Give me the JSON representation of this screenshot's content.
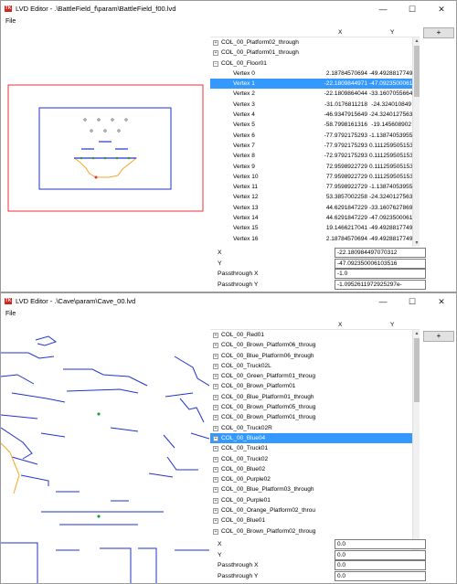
{
  "window1": {
    "title": "LVD Editor - .\\BattleField_f\\param\\BattleField_f00.lvd",
    "menu_file": "File",
    "col_x": "X",
    "col_y": "Y",
    "add_button": "+",
    "tree": [
      {
        "type": "group",
        "toggle": "+",
        "label": "COL_00_Platform02_through"
      },
      {
        "type": "group",
        "toggle": "+",
        "label": "COL_00_Platform01_through"
      },
      {
        "type": "group",
        "toggle": "−",
        "label": "COL_00_Floor01"
      },
      {
        "type": "vertex",
        "label": "Vertex 0",
        "x": "2.18784570694",
        "y": "-49.4928817749"
      },
      {
        "type": "vertex",
        "label": "Vertex 1",
        "x": "-22.1809844971",
        "y": "-47.0923500061",
        "selected": true
      },
      {
        "type": "vertex",
        "label": "Vertex 2",
        "x": "-22.1809864044",
        "y": "-33.1607055664"
      },
      {
        "type": "vertex",
        "label": "Vertex 3",
        "x": "-31.0176811218",
        "y": "-24.324010849"
      },
      {
        "type": "vertex",
        "label": "Vertex 4",
        "x": "-46.9347915649",
        "y": "-24.3240127563"
      },
      {
        "type": "vertex",
        "label": "Vertex 5",
        "x": "-58.7998161316",
        "y": "-19.145608902"
      },
      {
        "type": "vertex",
        "label": "Vertex 6",
        "x": "-77.9792175293",
        "y": "-1.13874053955"
      },
      {
        "type": "vertex",
        "label": "Vertex 7",
        "x": "-77.9792175293",
        "y": "0.111259505153"
      },
      {
        "type": "vertex",
        "label": "Vertex 8",
        "x": "-72.9792175293",
        "y": "0.111259505153"
      },
      {
        "type": "vertex",
        "label": "Vertex 9",
        "x": "72.9598922729",
        "y": "0.111259505153"
      },
      {
        "type": "vertex",
        "label": "Vertex 10",
        "x": "77.9598922729",
        "y": "0.111259505153"
      },
      {
        "type": "vertex",
        "label": "Vertex 11",
        "x": "77.9598922729",
        "y": "-1.13874053955"
      },
      {
        "type": "vertex",
        "label": "Vertex 12",
        "x": "53.3857002258",
        "y": "-24.3240127563"
      },
      {
        "type": "vertex",
        "label": "Vertex 13",
        "x": "44.6291847229",
        "y": "-33.1607627869"
      },
      {
        "type": "vertex",
        "label": "Vertex 14",
        "x": "44.6291847229",
        "y": "-47.0923500061"
      },
      {
        "type": "vertex",
        "label": "Vertex 15",
        "x": "19.1466217041",
        "y": "-49.4928817749"
      },
      {
        "type": "vertex",
        "label": "Vertex 16",
        "x": "2.18784570694",
        "y": "-49.4928817749"
      }
    ],
    "props": [
      {
        "label": "X",
        "value": "-22.180984497070312"
      },
      {
        "label": "Y",
        "value": "-47.092350006103516"
      },
      {
        "label": "Passthrough X",
        "value": "-1.0"
      },
      {
        "label": "Passthrough Y",
        "value": "-1.0952611972925297e-"
      }
    ]
  },
  "window2": {
    "title": "LVD Editor - .\\Cave\\param\\Cave_00.lvd",
    "menu_file": "File",
    "col_x": "X",
    "col_y": "Y",
    "add_button": "+",
    "tree": [
      {
        "type": "group",
        "toggle": "+",
        "label": "COL_00_Red01"
      },
      {
        "type": "group",
        "toggle": "+",
        "label": "COL_00_Brown_Platform06_throug"
      },
      {
        "type": "group",
        "toggle": "+",
        "label": "COL_00_Blue_Platform06_through"
      },
      {
        "type": "group",
        "toggle": "+",
        "label": "COL_00_Truck02L"
      },
      {
        "type": "group",
        "toggle": "+",
        "label": "COL_00_Green_Platform01_throug"
      },
      {
        "type": "group",
        "toggle": "+",
        "label": "COL_00_Brown_Platform01"
      },
      {
        "type": "group",
        "toggle": "+",
        "label": "COL_00_Blue_Platform01_through"
      },
      {
        "type": "group",
        "toggle": "+",
        "label": "COL_00_Brown_Platform05_throug"
      },
      {
        "type": "group",
        "toggle": "+",
        "label": "COL_00_Brown_Platform01_throug"
      },
      {
        "type": "group",
        "toggle": "+",
        "label": "COL_00_Truck02R"
      },
      {
        "type": "group",
        "toggle": "+",
        "label": "COL_00_Blue04",
        "selected": true
      },
      {
        "type": "group",
        "toggle": "+",
        "label": "COL_00_Truck01"
      },
      {
        "type": "group",
        "toggle": "+",
        "label": "COL_00_Truck02"
      },
      {
        "type": "group",
        "toggle": "+",
        "label": "COL_00_Blue02"
      },
      {
        "type": "group",
        "toggle": "+",
        "label": "COL_00_Purple02"
      },
      {
        "type": "group",
        "toggle": "+",
        "label": "COL_00_Blue_Platform03_through"
      },
      {
        "type": "group",
        "toggle": "+",
        "label": "COL_00_Purple01"
      },
      {
        "type": "group",
        "toggle": "+",
        "label": "COL_00_Orange_Platform02_throu"
      },
      {
        "type": "group",
        "toggle": "+",
        "label": "COL_00_Blue01"
      },
      {
        "type": "group",
        "toggle": "+",
        "label": "COL_00_Brown_Platform02_throug"
      }
    ],
    "props": [
      {
        "label": "X",
        "value": "0.0"
      },
      {
        "label": "Y",
        "value": "0.0"
      },
      {
        "label": "Passthrough X",
        "value": "0.0"
      },
      {
        "label": "Passthrough Y",
        "value": "0.0"
      }
    ]
  },
  "icons": {
    "app": "app-logo-icon",
    "minimize": "minimize-icon",
    "maximize": "maximize-icon",
    "close": "close-icon",
    "scroll_up": "scroll-up-icon",
    "scroll_down": "scroll-down-icon"
  },
  "colors": {
    "selection": "#3399ff",
    "collision_blue": "#2233cc",
    "blastzone_red": "#e8313a",
    "camera_blue": "#2233cc",
    "platform_orange": "#f5a623",
    "vertex_green": "#2e9e2e"
  }
}
